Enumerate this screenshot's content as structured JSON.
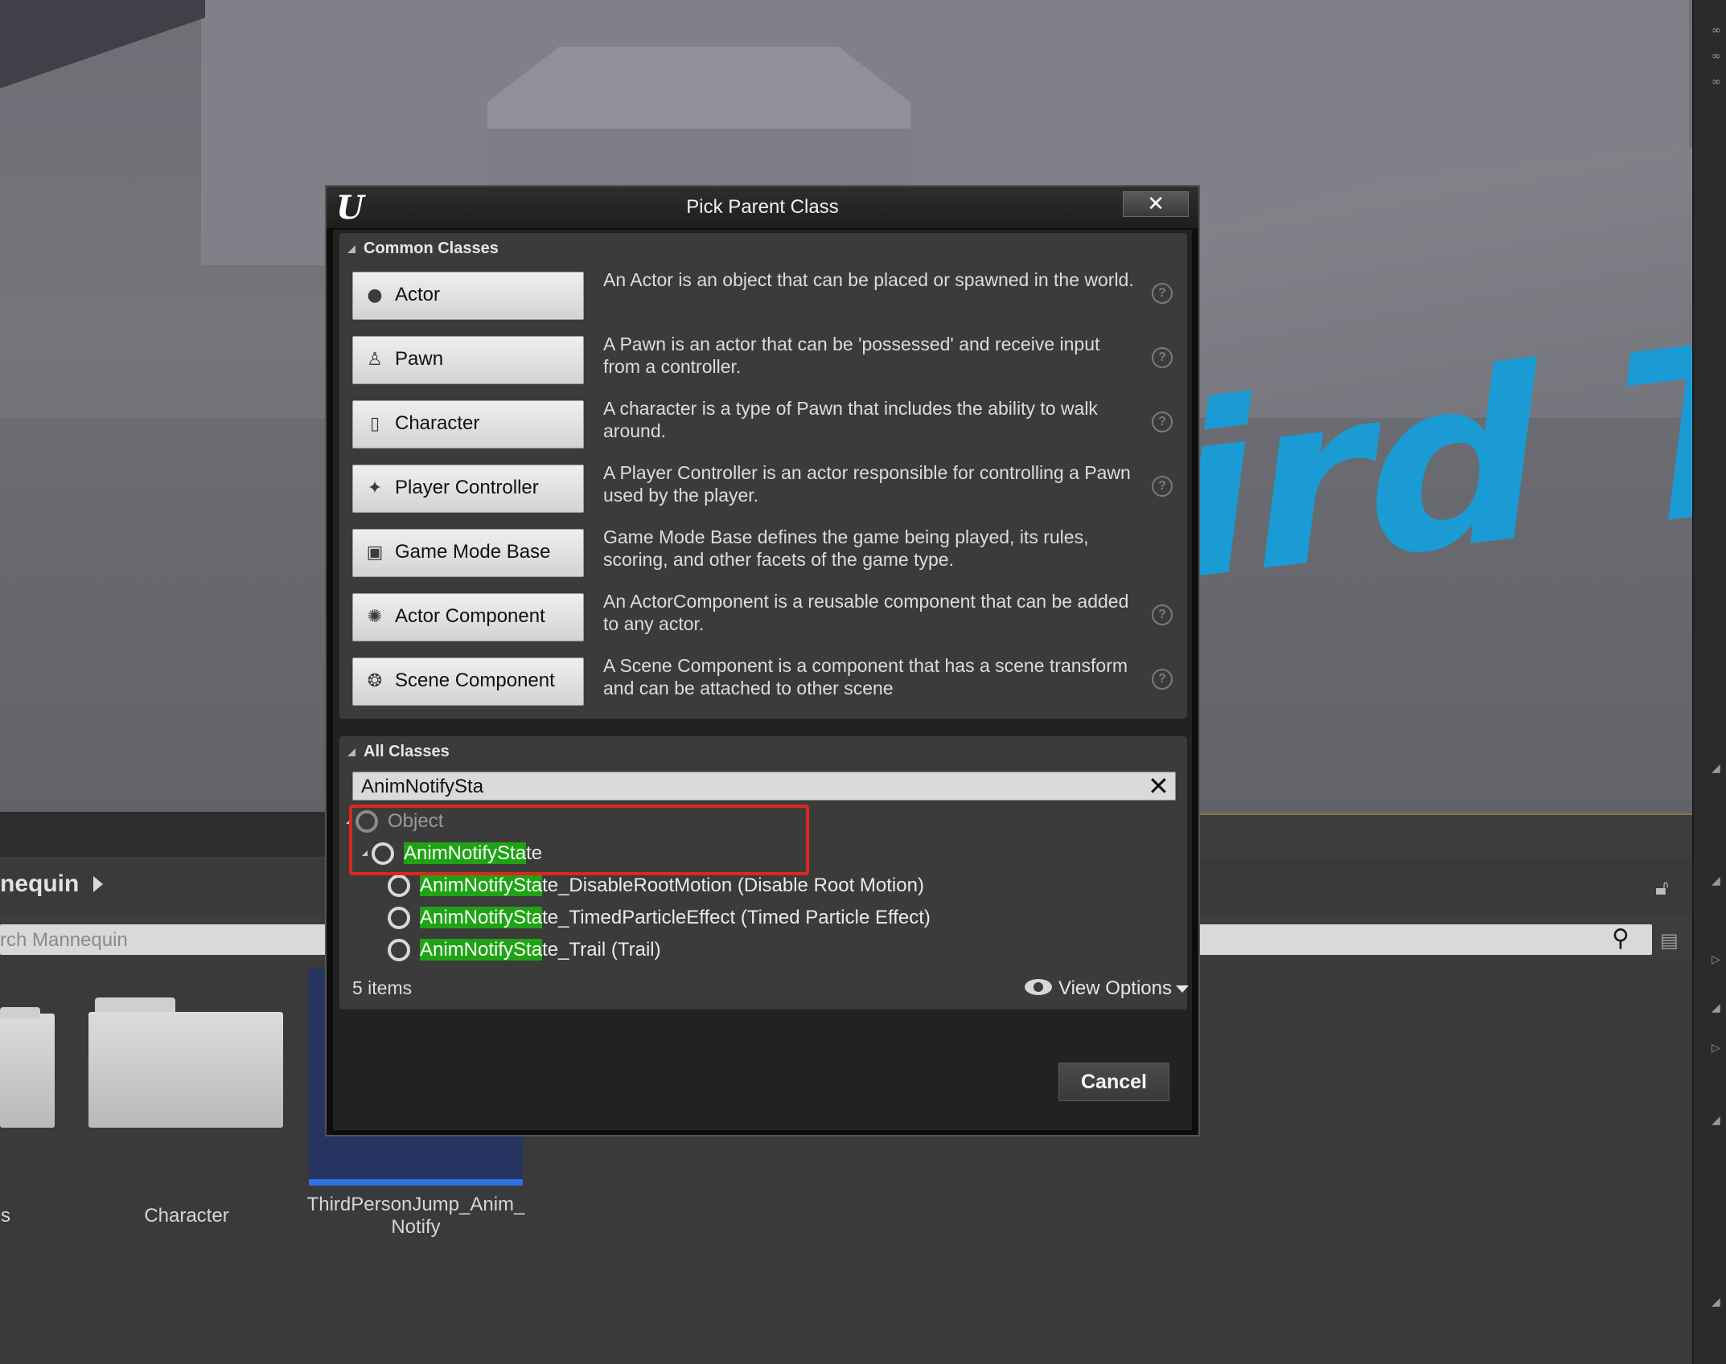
{
  "dialog": {
    "title": "Pick Parent Class",
    "close_label": "✕",
    "logo": "U"
  },
  "common_classes": {
    "header": "Common Classes",
    "items": [
      {
        "label": "Actor",
        "icon": "sphere-icon",
        "glyph": "●",
        "description": "An Actor is an object that can be placed or spawned in the world."
      },
      {
        "label": "Pawn",
        "icon": "pawn-icon",
        "glyph": "♙",
        "description": "A Pawn is an actor that can be 'possessed' and receive input from a controller."
      },
      {
        "label": "Character",
        "icon": "character-icon",
        "glyph": "▯",
        "description": "A character is a type of Pawn that includes the ability to walk around."
      },
      {
        "label": "Player Controller",
        "icon": "player-controller-icon",
        "glyph": "✦",
        "description": "A Player Controller is an actor responsible for controlling a Pawn used by the player."
      },
      {
        "label": "Game Mode Base",
        "icon": "game-mode-icon",
        "glyph": "▣",
        "description": "Game Mode Base defines the game being played, its rules, scoring, and other facets of the game type."
      },
      {
        "label": "Actor Component",
        "icon": "actor-component-icon",
        "glyph": "✺",
        "description": "An ActorComponent is a reusable component that can be added to any actor."
      },
      {
        "label": "Scene Component",
        "icon": "scene-component-icon",
        "glyph": "❂",
        "description": "A Scene Component is a component that has a scene transform and can be attached to other scene"
      }
    ],
    "help_glyph": "?"
  },
  "all_classes": {
    "header": "All Classes",
    "search_value": "AnimNotifySta",
    "search_clear": "✕",
    "tree": [
      {
        "match": "",
        "rest": "Object",
        "dim": true
      },
      {
        "match": "AnimNotifySta",
        "rest": "te"
      },
      {
        "match": "AnimNotifySta",
        "rest": "te_DisableRootMotion (Disable Root Motion)"
      },
      {
        "match": "AnimNotifySta",
        "rest": "te_TimedParticleEffect (Timed Particle Effect)"
      },
      {
        "match": "AnimNotifySta",
        "rest": "te_Trail (Trail)"
      }
    ],
    "item_count": "5 items",
    "view_options": "View Options"
  },
  "cancel_label": "Cancel",
  "content_browser": {
    "path": "nequin",
    "search_placeholder": "rch Mannequin",
    "assets": [
      {
        "label": "s"
      },
      {
        "label": "Character"
      },
      {
        "label": "ThirdPersonJump_Anim_\nNotify"
      }
    ]
  },
  "viewport": {
    "text": "ird T"
  },
  "colors": {
    "highlight": "#1fa315",
    "annotation": "#e0261c",
    "accent_text": "#1a9bd4"
  }
}
